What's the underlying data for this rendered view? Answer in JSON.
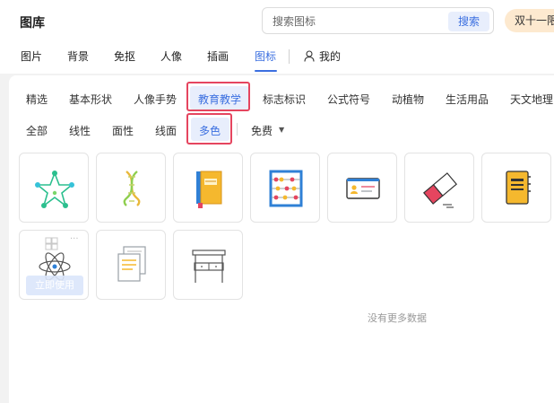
{
  "header": {
    "title": "图库",
    "search_placeholder": "搜索图标",
    "search_button": "搜索",
    "promo": "双十一限"
  },
  "top_nav": {
    "items": [
      "图片",
      "背景",
      "免抠",
      "人像",
      "插画",
      "图标"
    ],
    "active": "图标",
    "mine": "我的"
  },
  "categories": {
    "items": [
      "精选",
      "基本形状",
      "人像手势",
      "教育教学",
      "标志标识",
      "公式符号",
      "动植物",
      "生活用品",
      "天文地理"
    ],
    "active": "教育教学"
  },
  "styles": {
    "items": [
      "全部",
      "线性",
      "面性",
      "线面",
      "多色"
    ],
    "active": "多色",
    "price_filter": "免费"
  },
  "icons": [
    {
      "name": "star-network-icon"
    },
    {
      "name": "dna-icon"
    },
    {
      "name": "book-icon"
    },
    {
      "name": "abacus-icon"
    },
    {
      "name": "id-card-icon"
    },
    {
      "name": "eraser-icon"
    },
    {
      "name": "notebook-icon"
    },
    {
      "name": "atom-icon"
    },
    {
      "name": "documents-icon"
    },
    {
      "name": "desk-icon"
    }
  ],
  "hover_card": {
    "use_button": "立即使用"
  },
  "empty_message": "没有更多数据",
  "colors": {
    "accent": "#3b6fe0",
    "highlight": "#e5455f",
    "panel_bg": "#f2f2f2"
  }
}
